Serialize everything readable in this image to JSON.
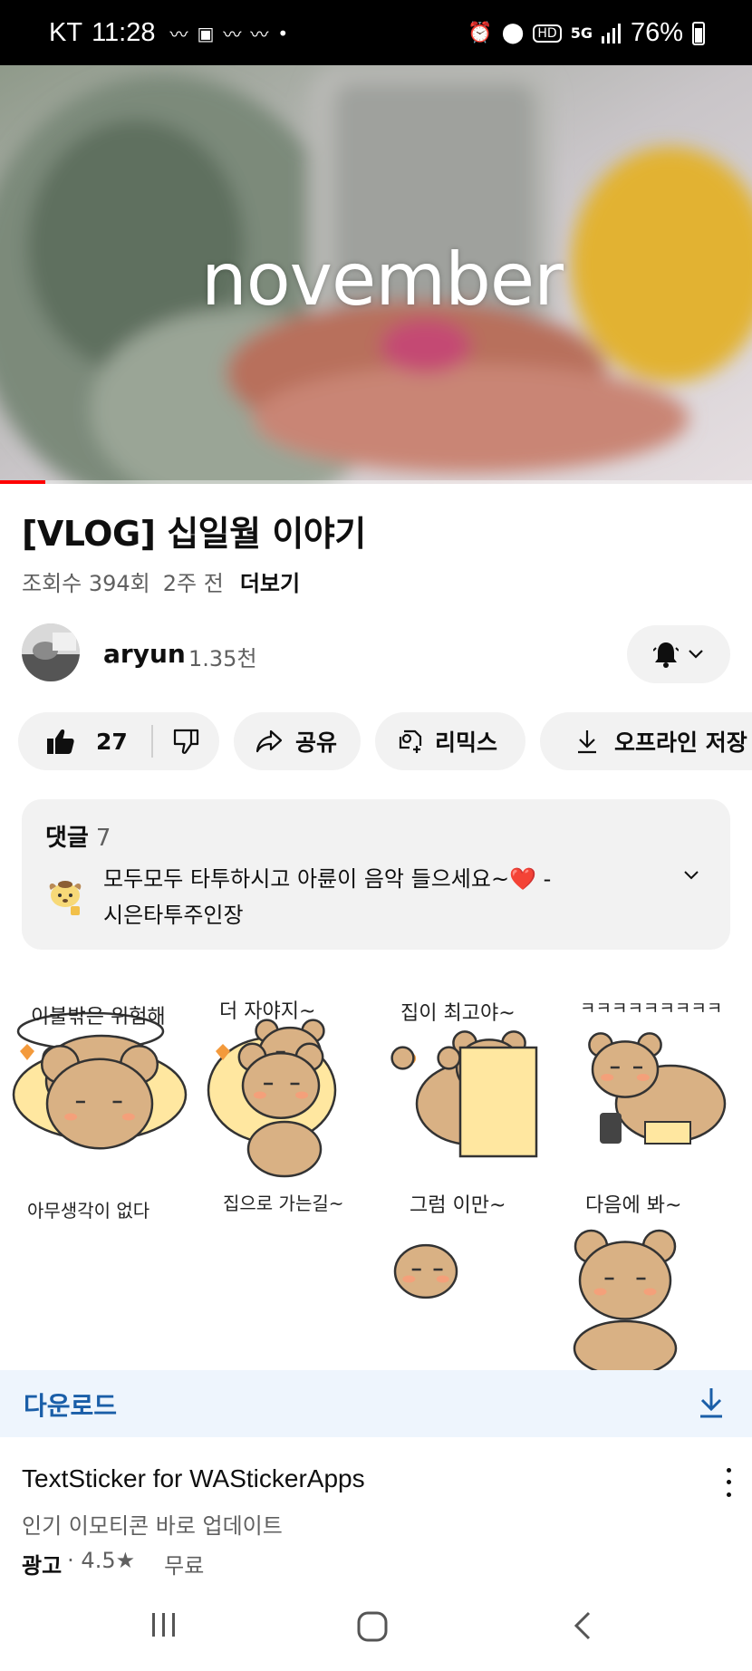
{
  "status_bar": {
    "carrier": "KT",
    "time": "11:28",
    "hd_label": "HD",
    "network": "5G",
    "battery_percent": "76%"
  },
  "video": {
    "overlay_text": "november",
    "progress_fraction": 0.06
  },
  "video_info": {
    "title": "[VLOG] 십일월 이야기",
    "views": "조회수 394회",
    "age": "2주 전",
    "more_label": "더보기"
  },
  "channel": {
    "name": "aryun",
    "subscribers": "1.35천"
  },
  "actions": {
    "like_count": "27",
    "share_label": "공유",
    "remix_label": "리믹스",
    "offline_label": "오프라인 저장"
  },
  "comments": {
    "header": "댓글",
    "count": "7",
    "top_comment_line1": "모두모두 타투하시고 아륜이 음악 들으세요~❤️ -",
    "top_comment_line2": "시은타투주인장"
  },
  "ad": {
    "stickers": [
      "이불밖은 위험해",
      "더 자야지~",
      "집이 최고야~",
      "ㅋㅋㅋㅋㅋㅋㅋㅋㅋ",
      "아무생각이 없다",
      "집으로 가는길~",
      "그럼 이만~",
      "다음에 봐~"
    ],
    "download_label": "다운로드",
    "app_title": "TextSticker for WAStickerApps",
    "app_subtitle": "인기 이모티콘 바로 업데이트",
    "ad_tag": "광고",
    "rating": "· 4.5★",
    "price": "무료"
  },
  "colors": {
    "accent_red": "#ff0000",
    "chip_bg": "#f2f2f2",
    "download_blue": "#1a5ea8",
    "bear": "#d9b184",
    "blanket": "#ffe7a0"
  }
}
